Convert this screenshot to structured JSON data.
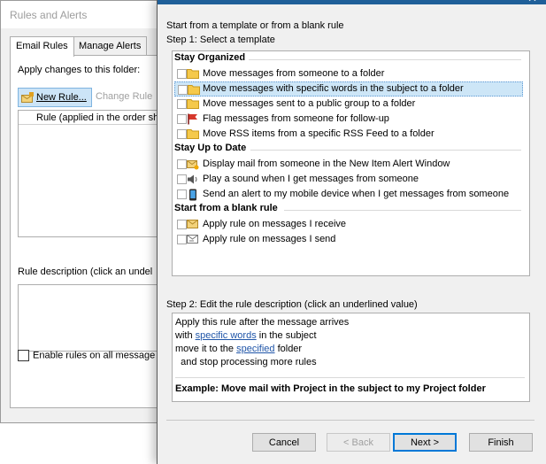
{
  "rules_alerts": {
    "title": "Rules and Alerts",
    "tabs": [
      {
        "label": "Email Rules"
      },
      {
        "label": "Manage Alerts"
      }
    ],
    "apply_changes_label": "Apply changes to this folder:",
    "new_rule_label": "New Rule...",
    "change_rule_label": "Change Rule",
    "list_header": "Rule (applied in the order sh",
    "rule_description_label": "Rule description (click an undel",
    "enable_rules_label": "Enable rules on all message"
  },
  "wizard": {
    "intro": "Start from a template or from a blank rule",
    "step1": "Step 1: Select a template",
    "groups": [
      {
        "title": "Stay Organized",
        "items": [
          {
            "label": "Move messages from someone to a folder",
            "icon": "folder-icon"
          },
          {
            "label": "Move messages with specific words in the subject to a folder",
            "icon": "folder-icon",
            "selected": true
          },
          {
            "label": "Move messages sent to a public group to a folder",
            "icon": "folder-icon"
          },
          {
            "label": "Flag messages from someone for follow-up",
            "icon": "flag-icon"
          },
          {
            "label": "Move RSS items from a specific RSS Feed to a folder",
            "icon": "folder-icon"
          }
        ]
      },
      {
        "title": "Stay Up to Date",
        "items": [
          {
            "label": "Display mail from someone in the New Item Alert Window",
            "icon": "mail-alert-icon"
          },
          {
            "label": "Play a sound when I get messages from someone",
            "icon": "speaker-icon"
          },
          {
            "label": "Send an alert to my mobile device when I get messages from someone",
            "icon": "mobile-icon"
          }
        ]
      },
      {
        "title": "Start from a blank rule",
        "items": [
          {
            "label": "Apply rule on messages I receive",
            "icon": "envelope-icon"
          },
          {
            "label": "Apply rule on messages I send",
            "icon": "envelope-send-icon"
          }
        ]
      }
    ],
    "step2": "Step 2: Edit the rule description (click an underlined value)",
    "description": {
      "line1": "Apply this rule after the message arrives",
      "line2_pre": "with ",
      "line2_link": "specific words",
      "line2_post": " in the subject",
      "line3_pre": "move it to the ",
      "line3_link": "specified",
      "line3_post": " folder",
      "line4": "  and stop processing more rules"
    },
    "example": "Example: Move mail with Project in the subject to my Project folder",
    "buttons": {
      "cancel": "Cancel",
      "back": "< Back",
      "next": "Next >",
      "finish": "Finish"
    }
  }
}
